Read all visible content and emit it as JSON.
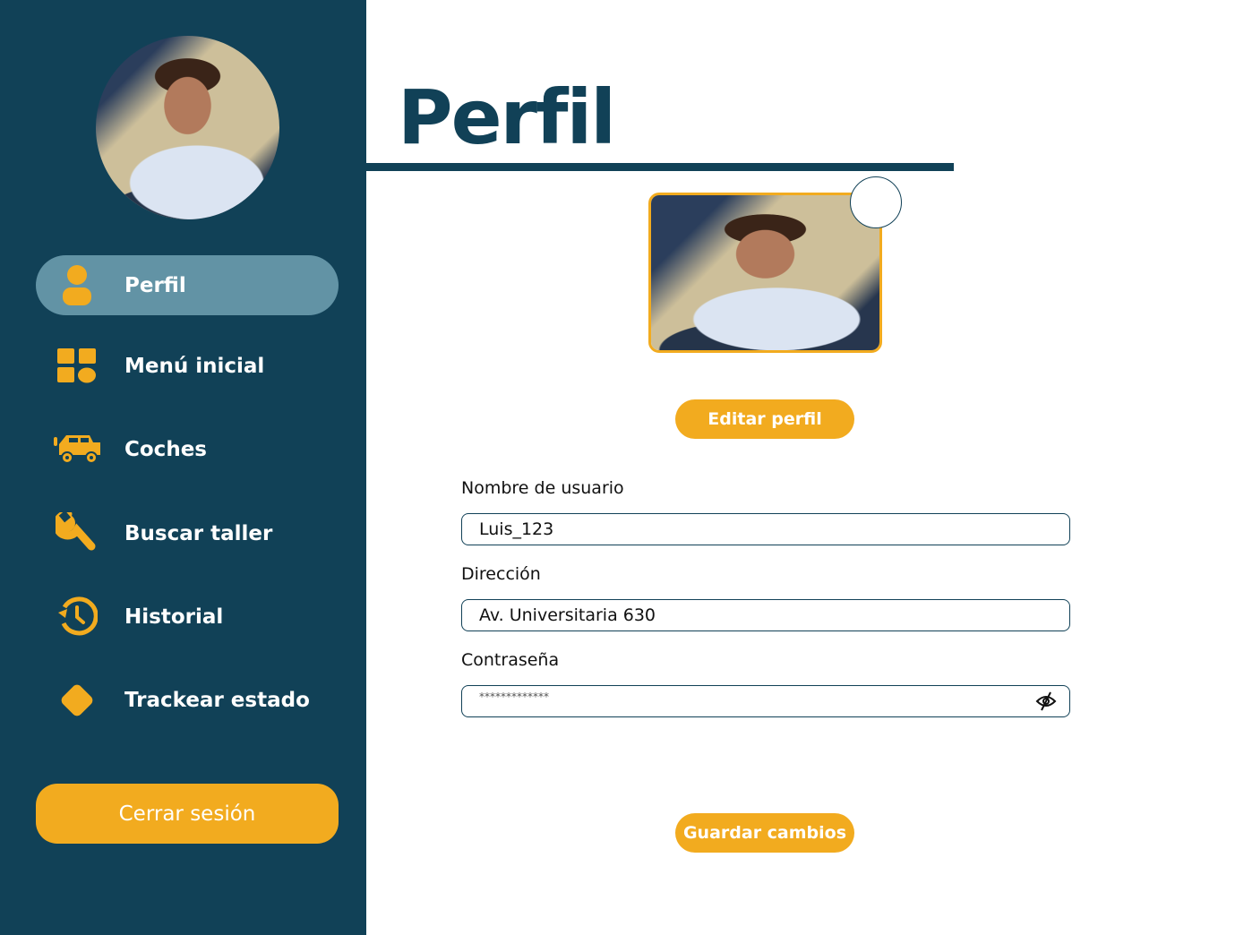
{
  "sidebar": {
    "items": [
      {
        "label": "Perfil",
        "icon": "user-icon"
      },
      {
        "label": "Menú inicial",
        "icon": "grid-icon"
      },
      {
        "label": "Coches",
        "icon": "car-icon"
      },
      {
        "label": "Buscar taller",
        "icon": "wrench-icon"
      },
      {
        "label": "Historial",
        "icon": "history-icon"
      },
      {
        "label": "Trackear estado",
        "icon": "diamond-icon"
      }
    ],
    "logout": "Cerrar sesión"
  },
  "main": {
    "title": "Perfil",
    "edit_button": "Editar perfil",
    "username_label": "Nombre de usuario",
    "username_value": "Luis_123",
    "address_label": "Dirección",
    "address_value": "Av. Universitaria 630",
    "password_label": "Contraseña",
    "password_value": "*************",
    "save_button": "Guardar cambios"
  },
  "colors": {
    "primary": "#114157",
    "accent": "#f2ab1f",
    "active": "#6293a5"
  }
}
